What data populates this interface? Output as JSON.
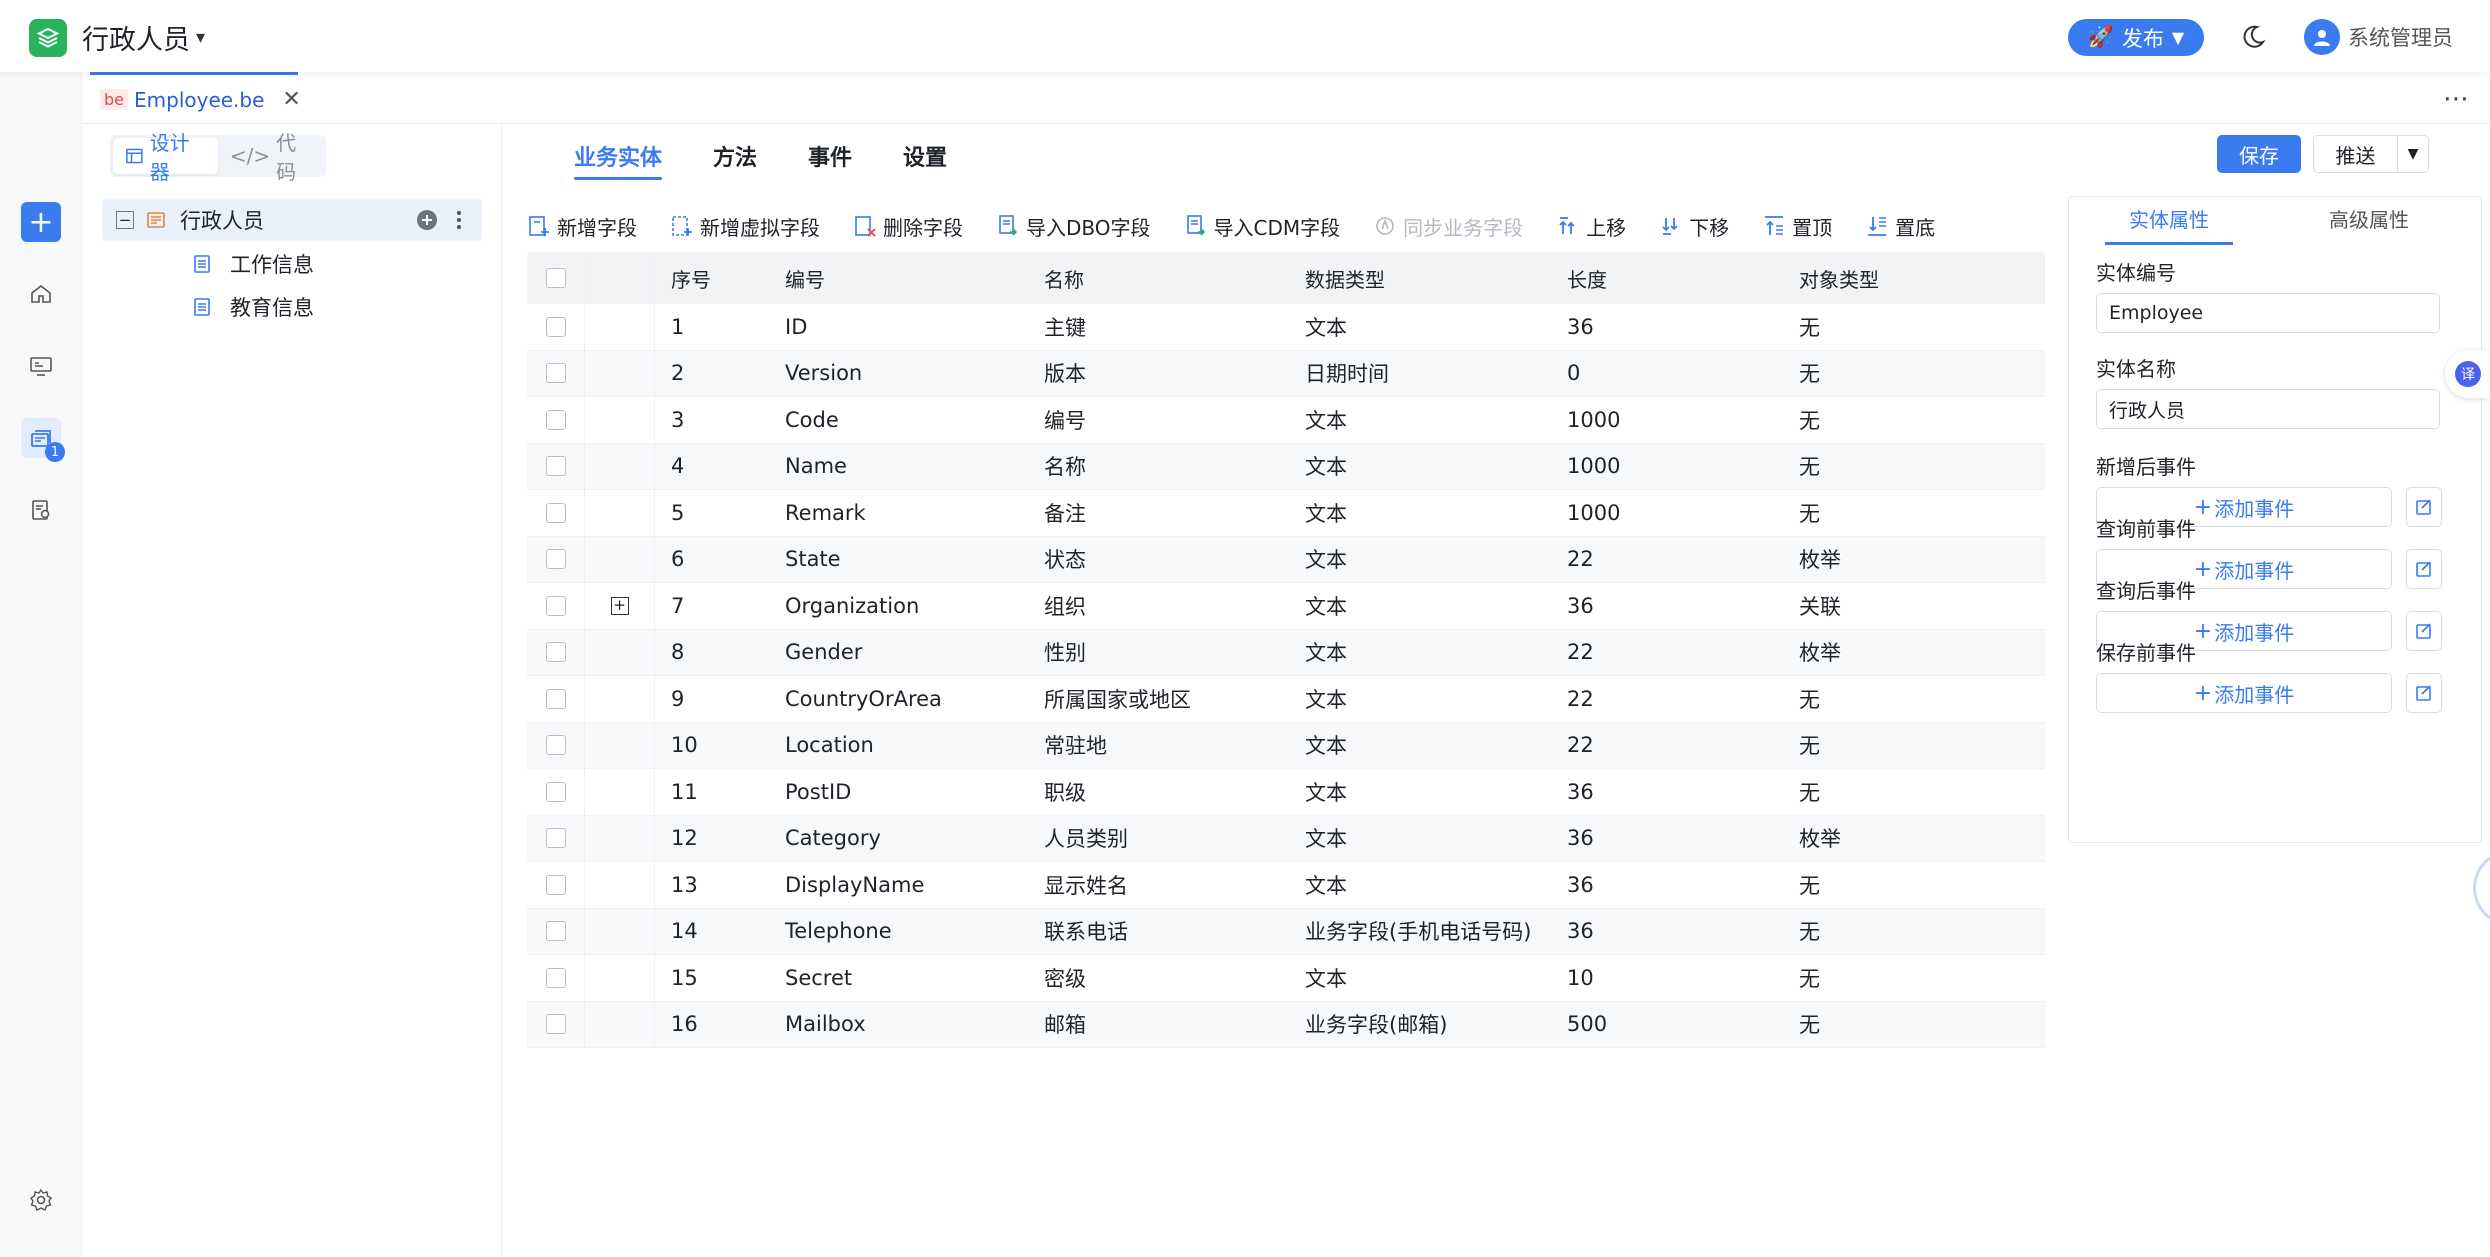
{
  "app": {
    "title": "行政人员"
  },
  "header": {
    "publish_label": "发布",
    "user_name": "系统管理员",
    "colors": {
      "accent": "#3a7bf0",
      "logo": "#27b35a"
    }
  },
  "rail": {
    "items": [
      "add-icon",
      "home-icon",
      "monitor-icon",
      "cards-icon",
      "report-icon",
      "settings-icon"
    ],
    "badge": "1"
  },
  "file_tab": {
    "tag": "be",
    "label": "Employee.be"
  },
  "tree": {
    "toggle": {
      "designer": "设计器",
      "code": "代码"
    },
    "root": "行政人员",
    "children": [
      "工作信息",
      "教育信息"
    ]
  },
  "main_tabs": [
    "业务实体",
    "方法",
    "事件",
    "设置"
  ],
  "actions": {
    "save": "保存",
    "push": "推送"
  },
  "toolbar": [
    {
      "label": "新增字段",
      "icon": "add-field-icon"
    },
    {
      "label": "新增虚拟字段",
      "icon": "add-virtual-field-icon"
    },
    {
      "label": "删除字段",
      "icon": "delete-field-icon"
    },
    {
      "label": "导入DBO字段",
      "icon": "import-dbo-icon"
    },
    {
      "label": "导入CDM字段",
      "icon": "import-cdm-icon"
    },
    {
      "label": "同步业务字段",
      "icon": "sync-icon",
      "disabled": true
    },
    {
      "label": "上移",
      "icon": "move-up-icon"
    },
    {
      "label": "下移",
      "icon": "move-down-icon"
    },
    {
      "label": "置顶",
      "icon": "move-top-icon"
    },
    {
      "label": "置底",
      "icon": "move-bottom-icon"
    }
  ],
  "table": {
    "headers": {
      "seq": "序号",
      "code": "编号",
      "name": "名称",
      "type": "数据类型",
      "length": "长度",
      "object": "对象类型"
    },
    "rows": [
      {
        "seq": "1",
        "code": "ID",
        "name": "主键",
        "type": "文本",
        "length": "36",
        "object": "无"
      },
      {
        "seq": "2",
        "code": "Version",
        "name": "版本",
        "type": "日期时间",
        "length": "0",
        "object": "无"
      },
      {
        "seq": "3",
        "code": "Code",
        "name": "编号",
        "type": "文本",
        "length": "1000",
        "object": "无"
      },
      {
        "seq": "4",
        "code": "Name",
        "name": "名称",
        "type": "文本",
        "length": "1000",
        "object": "无"
      },
      {
        "seq": "5",
        "code": "Remark",
        "name": "备注",
        "type": "文本",
        "length": "1000",
        "object": "无"
      },
      {
        "seq": "6",
        "code": "State",
        "name": "状态",
        "type": "文本",
        "length": "22",
        "object": "枚举"
      },
      {
        "seq": "7",
        "code": "Organization",
        "name": "组织",
        "type": "文本",
        "length": "36",
        "object": "关联",
        "expandable": true
      },
      {
        "seq": "8",
        "code": "Gender",
        "name": "性别",
        "type": "文本",
        "length": "22",
        "object": "枚举"
      },
      {
        "seq": "9",
        "code": "CountryOrArea",
        "name": "所属国家或地区",
        "type": "文本",
        "length": "22",
        "object": "无"
      },
      {
        "seq": "10",
        "code": "Location",
        "name": "常驻地",
        "type": "文本",
        "length": "22",
        "object": "无"
      },
      {
        "seq": "11",
        "code": "PostID",
        "name": "职级",
        "type": "文本",
        "length": "36",
        "object": "无"
      },
      {
        "seq": "12",
        "code": "Category",
        "name": "人员类别",
        "type": "文本",
        "length": "36",
        "object": "枚举"
      },
      {
        "seq": "13",
        "code": "DisplayName",
        "name": "显示姓名",
        "type": "文本",
        "length": "36",
        "object": "无"
      },
      {
        "seq": "14",
        "code": "Telephone",
        "name": "联系电话",
        "type": "业务字段(手机电话号码)",
        "length": "36",
        "object": "无"
      },
      {
        "seq": "15",
        "code": "Secret",
        "name": "密级",
        "type": "文本",
        "length": "10",
        "object": "无"
      },
      {
        "seq": "16",
        "code": "Mailbox",
        "name": "邮箱",
        "type": "业务字段(邮箱)",
        "length": "500",
        "object": "无"
      }
    ]
  },
  "props": {
    "tabs": [
      "实体属性",
      "高级属性"
    ],
    "entity_code_label": "实体编号",
    "entity_code": "Employee",
    "entity_name_label": "实体名称",
    "entity_name": "行政人员",
    "events": [
      {
        "label": "新增后事件",
        "button": "添加事件"
      },
      {
        "label": "查询前事件",
        "button": "添加事件"
      },
      {
        "label": "查询后事件",
        "button": "添加事件"
      },
      {
        "label": "保存前事件",
        "button": "添加事件"
      }
    ]
  },
  "translate_fab": "译"
}
